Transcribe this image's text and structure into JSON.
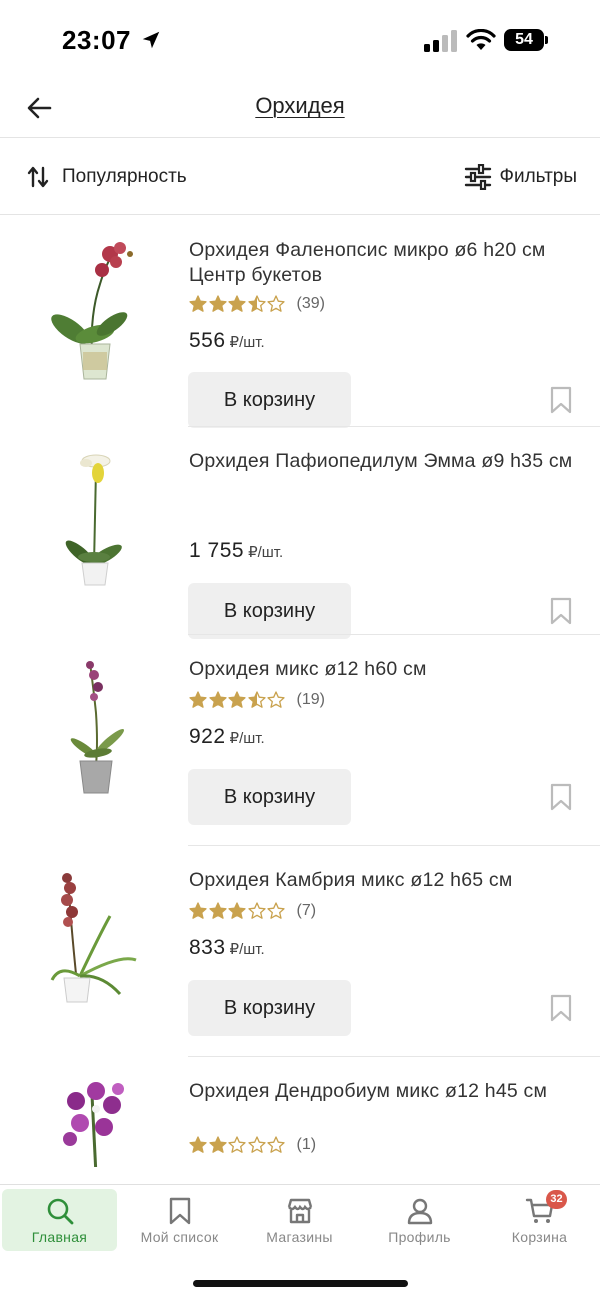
{
  "status_bar": {
    "time": "23:07",
    "battery": "54"
  },
  "header": {
    "title": "Орхидея"
  },
  "toolbar": {
    "sort_label": "Популярность",
    "filter_label": "Фильтры"
  },
  "products": [
    {
      "name": "Орхидея Фаленопсис микро ø6 h20 см Центр букетов",
      "rating": 3.5,
      "reviews": "(39)",
      "price": "556",
      "unit": "₽/шт.",
      "button": "В корзину",
      "image": "phalaenopsis-orchid"
    },
    {
      "name": "Орхидея Пафиопедилум Эмма ø9 h35 см",
      "rating": null,
      "reviews": "",
      "price": "1 755",
      "unit": "₽/шт.",
      "button": "В корзину",
      "image": "paphiopedilum-orchid"
    },
    {
      "name": "Орхидея микс ø12 h60 см",
      "rating": 3.5,
      "reviews": "(19)",
      "price": "922",
      "unit": "₽/шт.",
      "button": "В корзину",
      "image": "mix-orchid"
    },
    {
      "name": "Орхидея Камбрия микс ø12 h65 см",
      "rating": 3,
      "reviews": "(7)",
      "price": "833",
      "unit": "₽/шт.",
      "button": "В корзину",
      "image": "cambria-orchid"
    },
    {
      "name": "Орхидея Дендробиум микс ø12 h45 см",
      "rating": 2,
      "reviews": "(1)",
      "price": "",
      "unit": "",
      "button": "",
      "image": "dendrobium-orchid"
    }
  ],
  "tabs": [
    {
      "label": "Главная",
      "icon": "search-icon",
      "active": true
    },
    {
      "label": "Мой список",
      "icon": "bookmark-icon",
      "active": false
    },
    {
      "label": "Магазины",
      "icon": "store-icon",
      "active": false
    },
    {
      "label": "Профиль",
      "icon": "user-icon",
      "active": false
    },
    {
      "label": "Корзина",
      "icon": "cart-icon",
      "active": false
    }
  ],
  "cart_badge": "32",
  "colors": {
    "accent_green": "#2f8f3a",
    "active_tab_bg": "#e3f3e2",
    "star": "#c9a24e",
    "badge": "#d9574a"
  }
}
